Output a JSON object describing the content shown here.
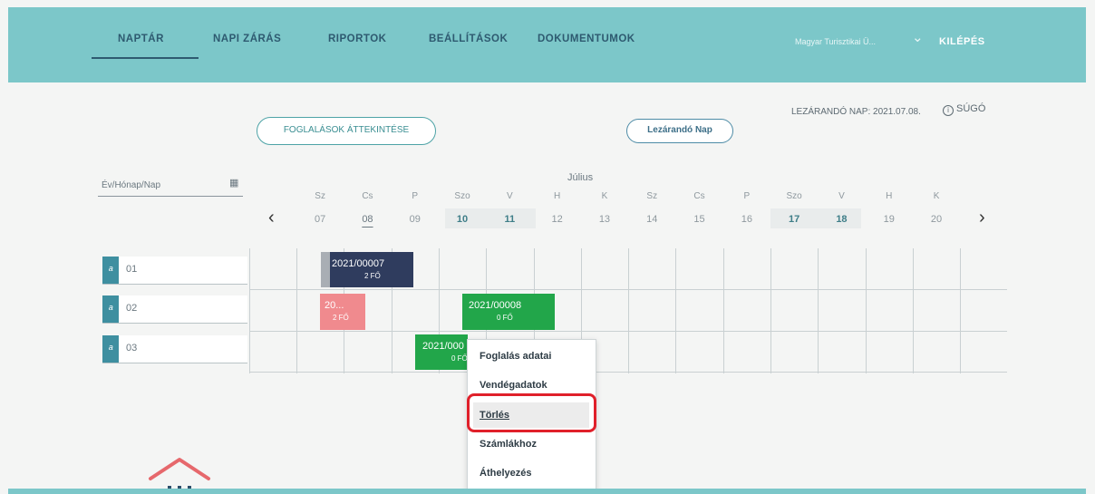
{
  "nav": {
    "items": [
      "NAPTÁR",
      "NAPI ZÁRÁS",
      "RIPORTOK",
      "BEÁLLÍTÁSOK",
      "DOKUMENTUMOK"
    ],
    "active_index": 0,
    "user": "Magyar Turisztikai Ü...",
    "logout": "KILÉPÉS"
  },
  "header": {
    "close_day_info": "LEZÁRANDÓ NAP: 2021.07.08.",
    "help": "SÚGÓ"
  },
  "buttons": {
    "overview": "FOGLALÁSOK ÁTTEKINTÉSE",
    "close_day": "Lezárandó Nap"
  },
  "date_picker": {
    "placeholder": "Év/Hónap/Nap"
  },
  "calendar": {
    "month": "Július",
    "days": [
      {
        "name": "Sz",
        "num": "07"
      },
      {
        "name": "Cs",
        "num": "08"
      },
      {
        "name": "P",
        "num": "09"
      },
      {
        "name": "Szo",
        "num": "10"
      },
      {
        "name": "V",
        "num": "11"
      },
      {
        "name": "H",
        "num": "12"
      },
      {
        "name": "K",
        "num": "13"
      },
      {
        "name": "Sz",
        "num": "14"
      },
      {
        "name": "Cs",
        "num": "15"
      },
      {
        "name": "P",
        "num": "16"
      },
      {
        "name": "Szo",
        "num": "17"
      },
      {
        "name": "V",
        "num": "18"
      },
      {
        "name": "H",
        "num": "19"
      },
      {
        "name": "K",
        "num": "20"
      }
    ],
    "rooms": [
      "01",
      "02",
      "03"
    ]
  },
  "bookings": [
    {
      "code": "2021/00007",
      "people": "2 FŐ",
      "color": "#2f3c5e"
    },
    {
      "code": "20...",
      "people": "2 FŐ",
      "color": "#f08a8e"
    },
    {
      "code": "2021/00008",
      "people": "0 FŐ",
      "color": "#22a64a"
    },
    {
      "code": "2021/000",
      "people": "0 FŐ",
      "color": "#22a64a"
    }
  ],
  "context_menu": {
    "items": [
      "Foglalás adatai",
      "Vendégadatok",
      "Törlés",
      "Számlákhoz",
      "Áthelyezés"
    ],
    "highlighted": "Törlés"
  },
  "colors": {
    "brand": "#7cc7c9",
    "accent": "#3e8fa0",
    "highlight_frame": "#e0202a"
  }
}
